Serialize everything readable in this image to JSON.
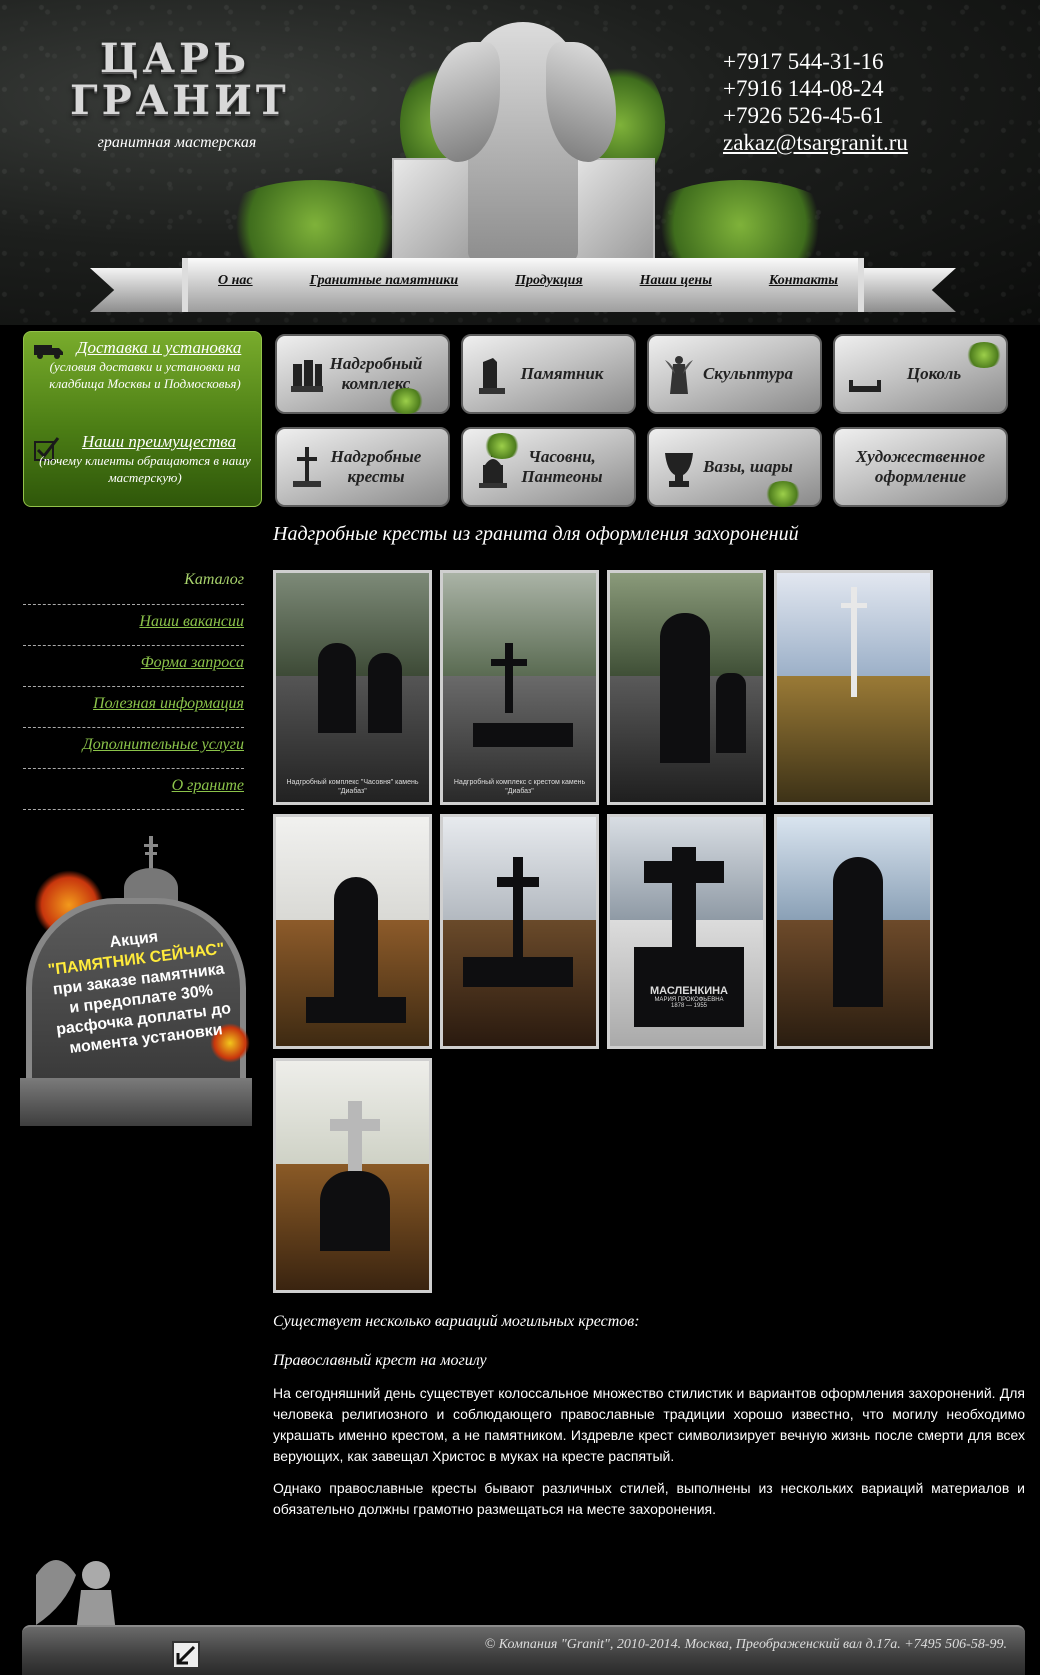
{
  "header": {
    "logo_line1": "ЦАРЬ",
    "logo_line2": "ГРАНИТ",
    "subtitle": "гранитная мастерская",
    "phones": [
      "+7917 544-31-16",
      "+7916 144-08-24",
      "+7926 526-45-61"
    ],
    "email": "zakaz@tsargranit.ru"
  },
  "nav": {
    "items": [
      "О нас",
      "Гранитные памятники",
      "Продукция",
      "Наши цены",
      "Контакты"
    ]
  },
  "green_box": {
    "delivery_title": "Доставка и установка",
    "delivery_desc": "(условия доставки и установки на кладбища Москвы и Подмосковья)",
    "advantages_title": "Наши преимущества",
    "advantages_desc": "(почему клиенты обращаются в нашу мастерскую)"
  },
  "categories": [
    {
      "label": "Надгробный комплекс",
      "icon": "tombstone-complex-icon"
    },
    {
      "label": "Памятник",
      "icon": "monument-icon"
    },
    {
      "label": "Скульптура",
      "icon": "sculpture-icon"
    },
    {
      "label": "Цоколь",
      "icon": "plinth-icon"
    },
    {
      "label": "Надгробные кресты",
      "icon": "cross-icon"
    },
    {
      "label": "Часовни, Пантеоны",
      "icon": "chapel-icon"
    },
    {
      "label": "Вазы, шары",
      "icon": "vase-icon"
    },
    {
      "label": "Художественное оформление",
      "icon": ""
    }
  ],
  "side_menu": {
    "items": [
      "Каталог",
      "Наши вакансии",
      "Форма запроса",
      "Полезная информация",
      "Дополнительные услуги",
      "О граните"
    ],
    "active_index": 0
  },
  "promo": {
    "line1": "Акция",
    "line2": "\"ПАМЯТНИК СЕЙЧАС\"",
    "line3": "при заказе памятника",
    "line4": "и предоплате 30%",
    "line5": "расфочка доплаты до",
    "line6": "момента установки"
  },
  "main": {
    "title": "Надгробные кресты из гранита для оформления захоронений",
    "gallery_captions": [
      "Надгробный комплекс \"Часовня\" камень \"Диабаз\"",
      "Надгробный комплекс с крестом камень \"Диабаз\"",
      "",
      "",
      "",
      "",
      "",
      "",
      ""
    ],
    "memorial_name": "МАСЛЕНКИНА",
    "memorial_sub": "МАРИЯ ПРОКОФЬЕВНА",
    "memorial_years": "1878 — 1955",
    "lead": "Существует несколько вариаций могильных крестов:",
    "heading": "Православный крест на могилу",
    "para1": "На сегодняшний день существует колоссальное множество стилистик и вариантов оформления захоронений. Для человека религиозного и соблюдающего православные традиции хорошо известно, что могилу необходимо украшать именно крестом, а не памятником. Издревле крест символизирует вечную жизнь после смерти для всех верующих, как завещал Христос в муках на кресте распятый.",
    "para2": "Однако православные кресты бывают различных стилей, выполнены из нескольких вариаций материалов и обязательно должны грамотно размещаться на месте захоронения."
  },
  "footer": {
    "copyright": "© Компания \"Granit\", 2010-2014. Москва, Преображенский вал д.17а. +7495 506-58-99."
  },
  "colors": {
    "green_box": "#4c7e15",
    "menu_link": "#8bc34a",
    "promo_highlight": "#ffeb3b"
  }
}
